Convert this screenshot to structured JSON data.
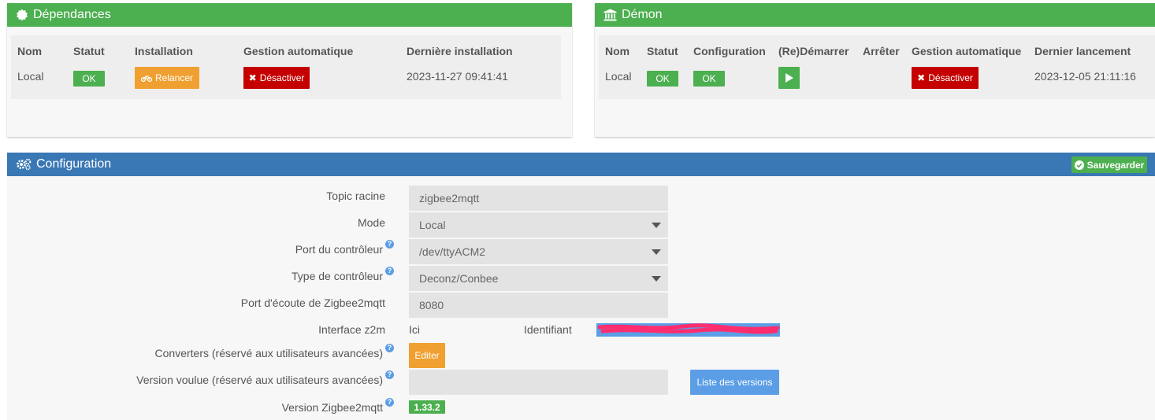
{
  "dependencies": {
    "title": "Dépendances",
    "columns": [
      "Nom",
      "Statut",
      "Installation",
      "Gestion automatique",
      "Dernière installation"
    ],
    "row": {
      "name": "Local",
      "status": "OK",
      "install_button": "Relancer",
      "auto_button": "Désactiver",
      "last_install": "2023-11-27 09:41:41"
    }
  },
  "daemon": {
    "title": "Démon",
    "columns": [
      "Nom",
      "Statut",
      "Configuration",
      "(Re)Démarrer",
      "Arrêter",
      "Gestion automatique",
      "Dernier lancement"
    ],
    "row": {
      "name": "Local",
      "status": "OK",
      "configuration": "OK",
      "auto_button": "Désactiver",
      "last_launch": "2023-12-05 21:11:16"
    }
  },
  "config": {
    "title": "Configuration",
    "save_button": "Sauvegarder",
    "topic_label": "Topic racine",
    "topic_value": "zigbee2mqtt",
    "mode_label": "Mode",
    "mode_value": "Local",
    "port_label": "Port du contrôleur",
    "port_value": "/dev/ttyACM2",
    "type_label": "Type de contrôleur",
    "type_value": "Deconz/Conbee",
    "listen_label": "Port d'écoute de Zigbee2mqtt",
    "listen_value": "8080",
    "interface_label": "Interface z2m",
    "interface_value": "Ici",
    "identifiant_label": "Identifiant",
    "converters_label": "Converters (réservé aux utilisateurs avancées)",
    "edit_button": "Editer",
    "version_wanted_label": "Version voulue (réservé aux utilisateurs avancées)",
    "version_wanted_value": "",
    "versions_list_button": "Liste des versions",
    "version_label": "Version Zigbee2mqtt",
    "version_value": "1.33.2",
    "help_glyph": "?"
  },
  "colors": {
    "green": "#4caf50",
    "blue": "#3a77b5",
    "orange": "#f0a030",
    "red": "#c40000",
    "light_blue": "#5b9ee6"
  }
}
